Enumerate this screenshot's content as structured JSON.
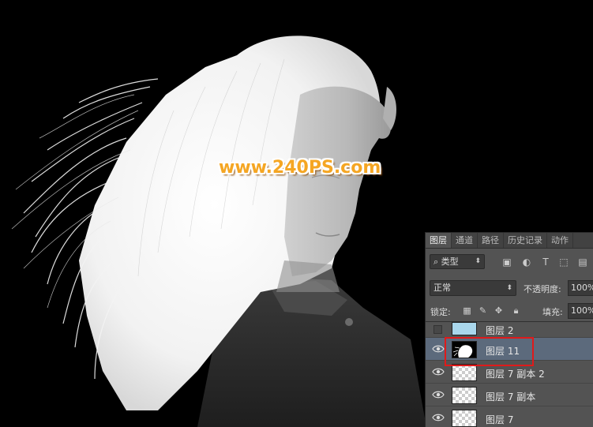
{
  "watermark": "www.240PS.com",
  "panel": {
    "tabs": [
      "图层",
      "通道",
      "路径",
      "历史记录",
      "动作"
    ],
    "active_tab": "图层",
    "filter": {
      "label": "类型",
      "icons": [
        "image-filter-icon",
        "adjustment-filter-icon",
        "type-filter-icon",
        "shape-filter-icon",
        "smart-object-filter-icon"
      ]
    },
    "blend_mode": "正常",
    "opacity_label": "不透明度:",
    "opacity_value": "100%",
    "lock_label": "锁定:",
    "lock_icons": [
      "lock-transparent-icon",
      "lock-brush-icon",
      "lock-move-icon",
      "lock-all-icon"
    ],
    "fill_label": "填充:",
    "fill_value": "100%",
    "layers": [
      {
        "name": "图层 2",
        "visible": false,
        "thumb": "light-blue",
        "selected": false
      },
      {
        "name": "图层 11",
        "visible": true,
        "thumb": "hair-mask",
        "selected": true
      },
      {
        "name": "图层 7 副本 2",
        "visible": true,
        "thumb": "transparent",
        "selected": false
      },
      {
        "name": "图层 7 副本",
        "visible": true,
        "thumb": "transparent",
        "selected": false
      },
      {
        "name": "图层 7",
        "visible": true,
        "thumb": "transparent",
        "selected": false
      }
    ]
  },
  "colors": {
    "watermark": "#f5a623",
    "panel_bg": "#535353",
    "selected_layer": "#5c6a7c",
    "highlight_box": "#e01a1a"
  }
}
